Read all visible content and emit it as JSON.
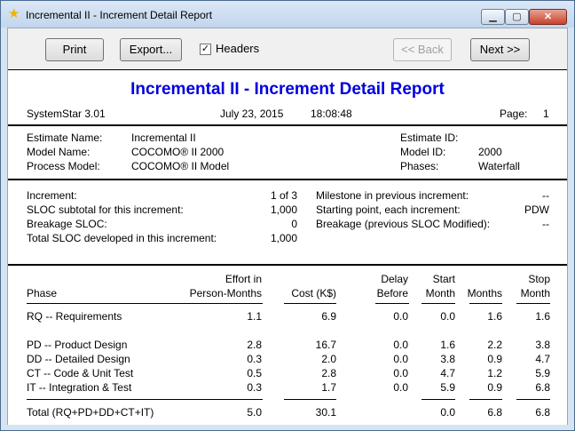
{
  "window": {
    "title": "Incremental II - Increment Detail Report",
    "min_glyph": "▁",
    "max_glyph": "▢",
    "close_glyph": "✕"
  },
  "toolbar": {
    "print": "Print",
    "export": "Export...",
    "headers_label": "Headers",
    "headers_checked": true,
    "check_glyph": "✓",
    "back": "<< Back",
    "next": "Next >>"
  },
  "report": {
    "title": "Incremental II - Increment Detail Report",
    "product": "SystemStar 3.01",
    "date": "July 23, 2015",
    "time": "18:08:48",
    "page_label": "Page:",
    "page": "1"
  },
  "estimate": {
    "name_label": "Estimate Name:",
    "name": "Incremental II",
    "model_label": "Model Name:",
    "model": "COCOMO® II 2000",
    "process_label": "Process Model:",
    "process": "COCOMO® II Model",
    "id_label": "Estimate ID:",
    "id": "",
    "model_id_label": "Model ID:",
    "model_id": "2000",
    "phases_label": "Phases:",
    "phases": "Waterfall"
  },
  "increment": {
    "inc_label": "Increment:",
    "inc_value": "1 of 3",
    "sloc_label": "SLOC subtotal for this increment:",
    "sloc_value": "1,000",
    "breakage_label": "Breakage SLOC:",
    "breakage_value": "0",
    "total_label": "Total SLOC developed in this increment:",
    "total_value": "1,000",
    "milestone_label": "Milestone in previous increment:",
    "milestone_value": "--",
    "start_label": "Starting point, each increment:",
    "start_value": "PDW",
    "breakage_prev_label": "Breakage (previous SLOC Modified):",
    "breakage_prev_value": "--"
  },
  "table": {
    "headers": {
      "phase": "Phase",
      "effort1": "Effort in",
      "effort2": "Person-Months",
      "cost": "Cost (K$)",
      "delay1": "Delay",
      "delay2": "Before",
      "start1": "Start",
      "start2": "Month",
      "months": "Months",
      "stop1": "Stop",
      "stop2": "Month"
    },
    "rows": [
      {
        "phase": "RQ --  Requirements",
        "effort": "1.1",
        "cost": "6.9",
        "delay": "0.0",
        "start": "0.0",
        "months": "1.6",
        "stop": "1.6"
      },
      {
        "phase": "PD --  Product Design",
        "effort": "2.8",
        "cost": "16.7",
        "delay": "0.0",
        "start": "1.6",
        "months": "2.2",
        "stop": "3.8"
      },
      {
        "phase": "DD --  Detailed Design",
        "effort": "0.3",
        "cost": "2.0",
        "delay": "0.0",
        "start": "3.8",
        "months": "0.9",
        "stop": "4.7"
      },
      {
        "phase": "CT --  Code & Unit Test",
        "effort": "0.5",
        "cost": "2.8",
        "delay": "0.0",
        "start": "4.7",
        "months": "1.2",
        "stop": "5.9"
      },
      {
        "phase": "IT  --  Integration & Test",
        "effort": "0.3",
        "cost": "1.7",
        "delay": "0.0",
        "start": "5.9",
        "months": "0.9",
        "stop": "6.8"
      }
    ],
    "total": {
      "phase": "Total (RQ+PD+DD+CT+IT)",
      "effort": "5.0",
      "cost": "30.1",
      "delay": "",
      "start": "0.0",
      "months": "6.8",
      "stop": "6.8"
    }
  }
}
